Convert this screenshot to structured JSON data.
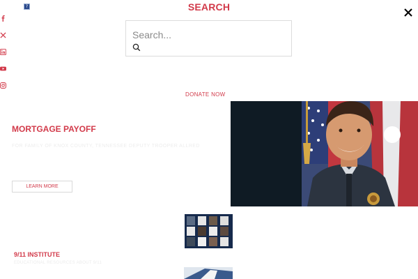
{
  "header": {
    "title": "SEARCH",
    "favicon_icon": "browser-favicon-icon",
    "close_icon": "close-icon"
  },
  "social": [
    {
      "name": "facebook-icon"
    },
    {
      "name": "x-twitter-icon"
    },
    {
      "name": "linkedin-icon"
    },
    {
      "name": "youtube-icon"
    },
    {
      "name": "instagram-icon"
    }
  ],
  "search": {
    "placeholder": "Search...",
    "icon": "search-icon"
  },
  "nav": {
    "donate_label": "DONATE NOW"
  },
  "hero": {
    "title": "MORTGAGE PAYOFF",
    "text": "FOR FAMILY OF KNOX COUNTY, TENNESSEE DEPUTY TROOPER ALLRED",
    "button_label": "LEARN MORE"
  },
  "institute": {
    "title": "9/11 INSTITUTE",
    "text": "EDUCATIONAL RESOURCES ABOUT 9/11"
  },
  "colors": {
    "accent": "#d23a4a",
    "social": "#d23a4a",
    "hero_bg": "#0f1b24"
  }
}
